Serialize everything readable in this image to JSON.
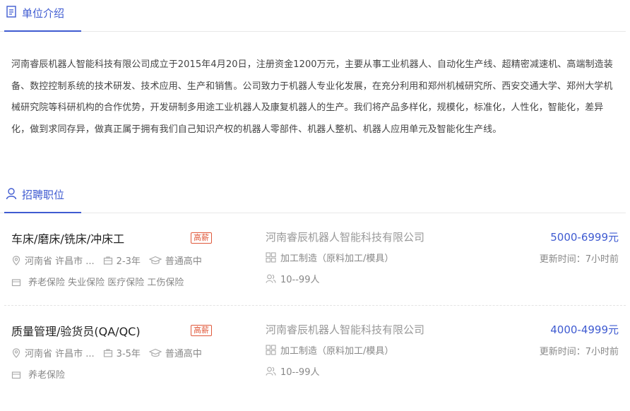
{
  "intro": {
    "heading": "单位介绍",
    "icon": "document-icon",
    "paragraph": "河南睿辰机器人智能科技有限公司成立于2015年4月20日，注册资金1200万元，主要从事工业机器人、自动化生产线、超精密减速机、高端制造装备、数控控制系统的技术研发、技术应用、生产和销售。公司致力于机器人专业化发展，在充分利用和郑州机械研究所、西安交通大学、郑州大学机械研究院等科研机构的合作优势，开发研制多用途工业机器人及康复机器人的生产。我们将产品多样化，规模化，标准化，人性化，智能化，差异化，做到求同存异，做真正属于拥有我们自己知识产权的机器人零部件、机器人整机、机器人应用单元及智能化生产线。"
  },
  "jobs_section": {
    "heading": "招聘职位",
    "icon": "user-icon"
  },
  "jobs": [
    {
      "title": "车床/磨床/铣床/冲床工",
      "badge": "高薪",
      "location": "河南省 许昌市 ...",
      "experience": "2-3年",
      "education": "普通高中",
      "benefits": "养老保险 失业保险 医疗保险 工伤保险",
      "company": "河南睿辰机器人智能科技有限公司",
      "industry": "加工制造（原料加工/模具）",
      "size": "10--99人",
      "salary": "5000-6999元",
      "updated": "更新时间：7小时前"
    },
    {
      "title": "质量管理/验货员(QA/QC)",
      "badge": "高薪",
      "location": "河南省 许昌市 ...",
      "experience": "3-5年",
      "education": "普通高中",
      "benefits": "养老保险",
      "company": "河南睿辰机器人智能科技有限公司",
      "industry": "加工制造（原料加工/模具）",
      "size": "10--99人",
      "salary": "4000-4999元",
      "updated": "更新时间：7小时前"
    }
  ],
  "colors": {
    "accent": "#3f5bd1",
    "badge": "#e0583a"
  }
}
